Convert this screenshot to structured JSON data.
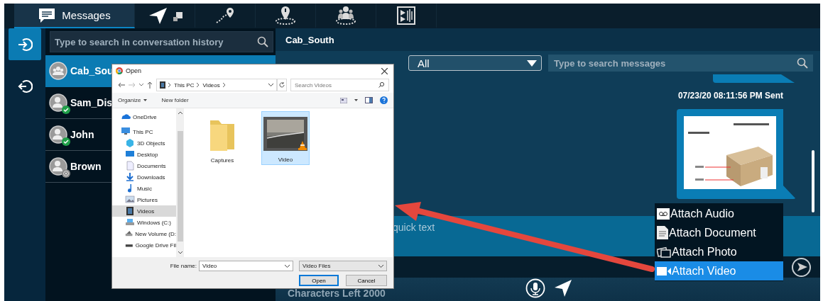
{
  "nav_tabs": [
    {
      "label": "Messages",
      "selected": true
    },
    {
      "selected": false
    },
    {
      "selected": false
    },
    {
      "selected": false
    },
    {
      "selected": false
    },
    {
      "selected": false
    }
  ],
  "rail_buttons": [
    {
      "selected": true
    },
    {
      "selected": false
    }
  ],
  "conversation_search": {
    "placeholder": "Type to search in conversation history"
  },
  "contacts": [
    {
      "name": "Cab_Sou",
      "kind": "group",
      "selected": true
    },
    {
      "name": "Sam_Dis",
      "kind": "person",
      "online": true,
      "selected": false
    },
    {
      "name": "John",
      "kind": "person",
      "online": true,
      "selected": false
    },
    {
      "name": "Brown",
      "kind": "person",
      "online": false,
      "selected": false
    }
  ],
  "conversation": {
    "title": "Cab_South",
    "filter": "All",
    "search_placeholder": "Type to search messages",
    "messages": [
      {
        "timestamp": "07/23/20 08:11:56 PM Sent",
        "kind": "picture"
      }
    ]
  },
  "compose": {
    "placeholder": "quick text",
    "characters_left": "Characters Left 2000"
  },
  "attach_menu": [
    {
      "label": "Attach Audio",
      "selected": false
    },
    {
      "label": "Attach Document",
      "selected": false
    },
    {
      "label": "Attach Photo",
      "selected": false
    },
    {
      "label": "Attach Video",
      "selected": true
    }
  ],
  "open_dialog": {
    "title": "Open",
    "path": [
      "This PC",
      "Videos"
    ],
    "search_placeholder": "Search Videos",
    "toolbar": [
      "Organize",
      "New folder"
    ],
    "nav_items": [
      {
        "label": "OneDrive",
        "selected": false
      },
      {
        "label": "This PC",
        "selected": false,
        "children": [
          {
            "label": "3D Objects",
            "selected": false
          },
          {
            "label": "Desktop",
            "selected": false
          },
          {
            "label": "Documents",
            "selected": false
          },
          {
            "label": "Downloads",
            "selected": false
          },
          {
            "label": "Music",
            "selected": false
          },
          {
            "label": "Pictures",
            "selected": false
          },
          {
            "label": "Videos",
            "selected": true
          },
          {
            "label": "Windows (C:)",
            "selected": false
          },
          {
            "label": "New Volume (D:",
            "selected": false
          },
          {
            "label": "Google Drive Fil",
            "selected": false
          }
        ]
      }
    ],
    "files": [
      {
        "name": "Captures",
        "kind": "folder",
        "selected": false
      },
      {
        "name": "Video",
        "kind": "video",
        "selected": true
      }
    ],
    "file_name_label": "File name:",
    "file_name": "Video",
    "file_type": "Video Files",
    "buttons": [
      {
        "label": "Open",
        "kind": "default"
      },
      {
        "label": "Cancel",
        "kind": "normal"
      }
    ]
  }
}
